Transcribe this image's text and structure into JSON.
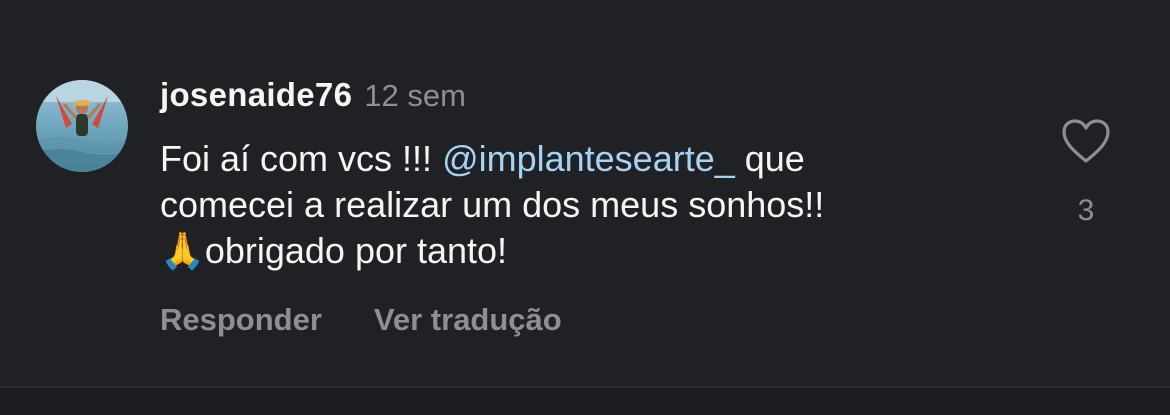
{
  "comment": {
    "username": "josenaide76",
    "timestamp": "12 sem",
    "text_before_mention": "Foi aí com vcs !!! ",
    "mention": "@implantesearte_",
    "text_after_mention": " que",
    "line2": "comecei a realizar um dos meus sonhos!!",
    "emoji": "🙏",
    "line3_text": "obrigado por tanto!",
    "actions": {
      "reply_label": "Responder",
      "translate_label": "Ver tradução"
    },
    "likes": {
      "count": "3",
      "icon": "heart-outline-icon"
    },
    "avatar_icon": "avatar-photo"
  },
  "colors": {
    "background": "#202124",
    "text": "#f5f5f5",
    "secondary": "#8e8e93",
    "mention": "#a6d3f5"
  }
}
